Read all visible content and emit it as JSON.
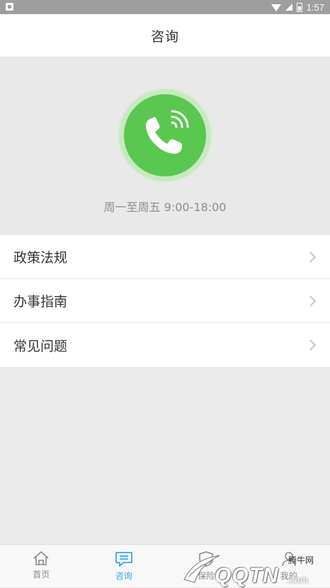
{
  "status_bar": {
    "time": "1:57"
  },
  "header": {
    "title": "咨询"
  },
  "hero": {
    "hours": "周一至周五 9:00-18:00"
  },
  "menu": {
    "items": [
      {
        "label": "政策法规"
      },
      {
        "label": "办事指南"
      },
      {
        "label": "常见问题"
      }
    ]
  },
  "tabbar": {
    "tabs": [
      {
        "label": "首页",
        "icon": "home-icon",
        "active": false
      },
      {
        "label": "咨询",
        "icon": "chat-icon",
        "active": true
      },
      {
        "label": "保险",
        "icon": "shield-icon",
        "active": false
      },
      {
        "label": "我的",
        "icon": "user-icon",
        "active": false
      }
    ]
  },
  "watermark": {
    "cn": "腾牛网",
    "logo": "QQTN",
    "suffix": ".com"
  },
  "colors": {
    "accent": "#39a7e0",
    "call_green": "#5ac750",
    "status_bar": "#9e9e9e"
  }
}
